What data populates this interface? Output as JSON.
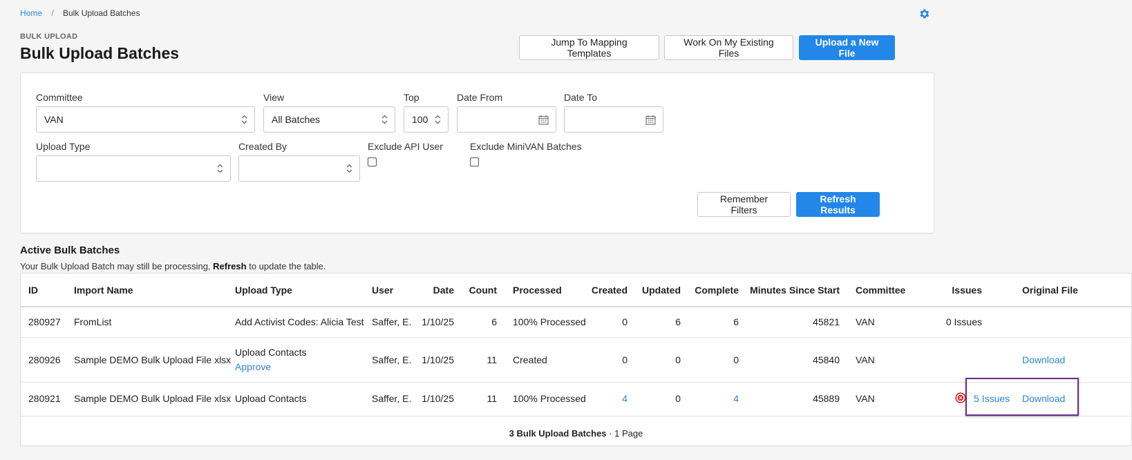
{
  "breadcrumb": {
    "home": "Home",
    "separator": "/",
    "current": "Bulk Upload Batches"
  },
  "header": {
    "kicker": "BULK UPLOAD",
    "title": "Bulk Upload Batches",
    "buttons": {
      "mapping": "Jump To Mapping Templates",
      "existing": "Work On My Existing Files",
      "upload": "Upload a New File"
    }
  },
  "filters": {
    "committee": {
      "label": "Committee",
      "value": "VAN"
    },
    "view": {
      "label": "View",
      "value": "All Batches"
    },
    "top": {
      "label": "Top",
      "value": "100"
    },
    "date_from": {
      "label": "Date From",
      "value": ""
    },
    "date_to": {
      "label": "Date To",
      "value": ""
    },
    "upload_type": {
      "label": "Upload Type",
      "value": ""
    },
    "created_by": {
      "label": "Created By",
      "value": ""
    },
    "exclude_api": {
      "label": "Exclude API User",
      "checked": false
    },
    "exclude_minivan": {
      "label": "Exclude MiniVAN Batches",
      "checked": false
    },
    "remember": "Remember Filters",
    "refresh": "Refresh Results"
  },
  "table_section": {
    "title": "Active Bulk Batches",
    "note_prefix": "Your Bulk Upload Batch may still be processing, ",
    "note_bold": "Refresh",
    "note_suffix": " to update the table."
  },
  "table": {
    "headers": {
      "id": "ID",
      "import_name": "Import Name",
      "upload_type": "Upload Type",
      "user": "User",
      "date": "Date",
      "count": "Count",
      "processed": "Processed",
      "created": "Created",
      "updated": "Updated",
      "complete": "Complete",
      "minutes": "Minutes Since Start",
      "committee": "Committee",
      "issues": "Issues",
      "original_file": "Original File"
    },
    "rows": [
      {
        "id": "280927",
        "import_name": "FromList",
        "upload_type": "Add Activist Codes: Alicia Test",
        "upload_action": "",
        "user": "Saffer, E.",
        "date": "1/10/25",
        "count": "6",
        "processed": "100% Processed",
        "created": "0",
        "updated": "6",
        "complete": "6",
        "minutes": "45821",
        "committee": "VAN",
        "issues": "0 Issues",
        "original_file": ""
      },
      {
        "id": "280926",
        "import_name": "Sample DEMO Bulk Upload File xlsx",
        "upload_type": "Upload Contacts",
        "upload_action": "Approve",
        "user": "Saffer, E.",
        "date": "1/10/25",
        "count": "11",
        "processed": "Created",
        "created": "0",
        "updated": "0",
        "complete": "0",
        "minutes": "45840",
        "committee": "VAN",
        "issues": "",
        "original_file": "Download"
      },
      {
        "id": "280921",
        "import_name": "Sample DEMO Bulk Upload File xlsx",
        "upload_type": "Upload Contacts",
        "upload_action": "",
        "user": "Saffer, E.",
        "date": "1/10/25",
        "count": "11",
        "processed": "100% Processed",
        "created": "4",
        "updated": "0",
        "complete": "4",
        "minutes": "45889",
        "committee": "VAN",
        "issues": "5 Issues",
        "original_file": "Download"
      }
    ],
    "footer_bold": "3 Bulk Upload Batches",
    "footer_rest": " · 1 Page"
  },
  "icons": {
    "gear": "gear-icon",
    "chevron": "chevron-updown-icon",
    "calendar": "calendar-icon",
    "error": "error-circle-icon"
  },
  "colors": {
    "accent": "#2287e8",
    "link": "#2d86d6",
    "error": "#e02020",
    "highlight": "#6a2e88"
  }
}
